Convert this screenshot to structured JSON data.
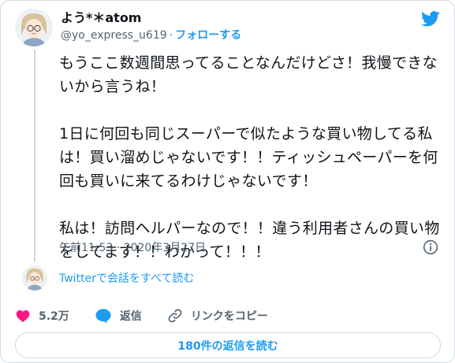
{
  "author": {
    "display_name": "よう*＊atom",
    "handle": "@yo_express_u619",
    "separator": "·",
    "follow_label": "フォローする"
  },
  "tweet": {
    "paragraphs": [
      "もうここ数週間思ってることなんだけどさ！我慢できないから言うね！",
      "1日に何回も同じスーパーで似たような買い物してる私は！買い溜めじゃないです！！ティッシュペーパーを何回も買いに来てるわけじゃないです！",
      "私は！訪問ヘルパーなので！！違う利用者さんの買い物をしてます！！わかって！！！"
    ],
    "timestamp": "午前11:53 · 2020年3月27日"
  },
  "thread_link": "Twitterで会話をすべて読む",
  "actions": {
    "like_count": "5.2万",
    "reply_label": "返信",
    "copy_link_label": "リンクをコピー"
  },
  "replies_button": "180件の返信を読む",
  "colors": {
    "accent": "#1d9bf0",
    "like": "#f91880",
    "muted": "#536471",
    "text": "#0f1419",
    "border": "#cfd9de"
  },
  "icons": [
    "twitter-bird-icon",
    "info-icon",
    "heart-icon",
    "reply-bubble-icon",
    "link-icon"
  ]
}
